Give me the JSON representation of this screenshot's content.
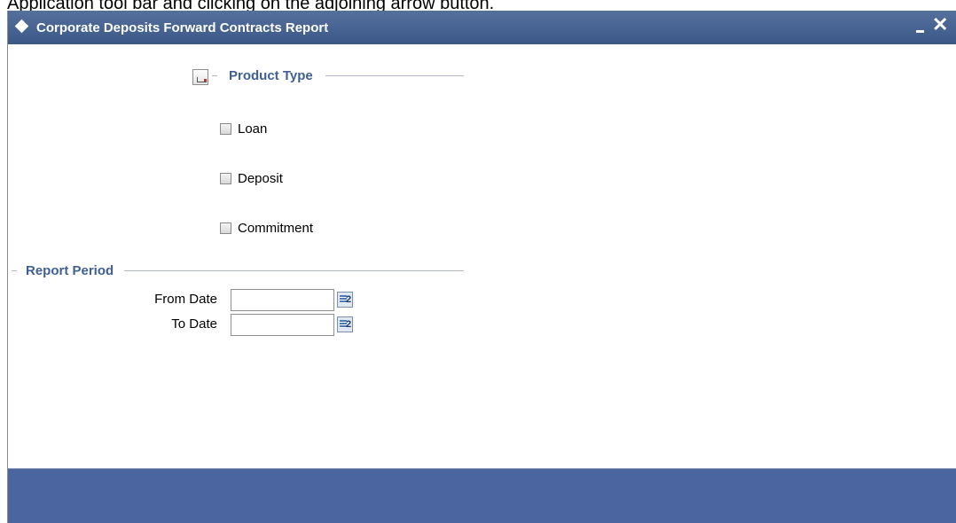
{
  "doc": {
    "text": "Application tool bar and clicking on the adjoining arrow button."
  },
  "window": {
    "title": "Corporate Deposits Forward Contracts Report",
    "minimize_icon": "minimize-icon",
    "close_symbol": "✕"
  },
  "product_type": {
    "title": "Product Type",
    "options": [
      {
        "label": "Loan",
        "checked": false
      },
      {
        "label": "Deposit",
        "checked": false
      },
      {
        "label": "Commitment",
        "checked": false
      }
    ]
  },
  "report_period": {
    "title": "Report Period",
    "from_label": "From Date",
    "from_value": "",
    "to_label": "To Date",
    "to_value": "",
    "calendar_icon_text": "2"
  },
  "colors": {
    "title_bar": "#3a5888",
    "section_title": "#3f5f95",
    "footer": "#4a65a0"
  }
}
